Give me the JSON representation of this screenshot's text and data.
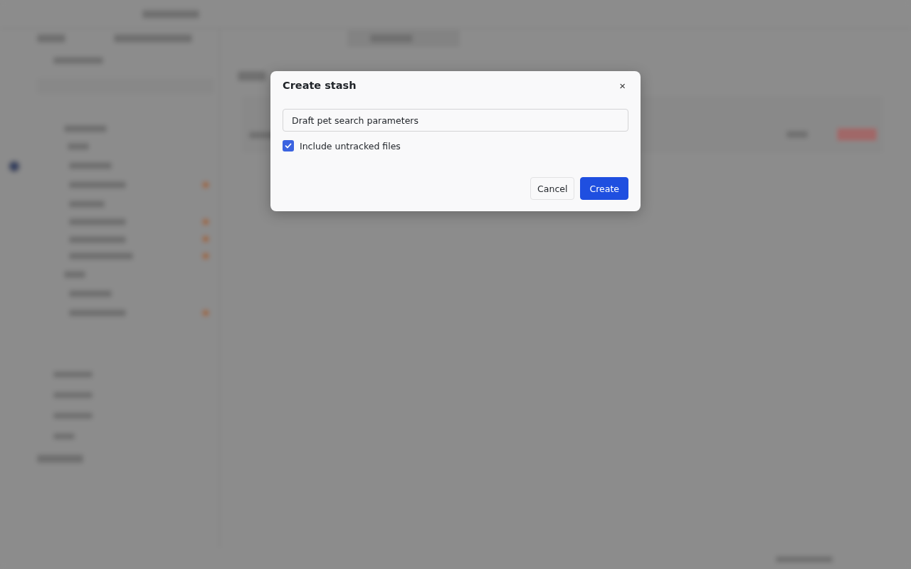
{
  "dialog": {
    "title": "Create stash",
    "close": "×",
    "name_field": {
      "value": "Draft pet search parameters"
    },
    "include_untracked": {
      "label": "Include untracked files",
      "checked": true
    },
    "buttons": [
      {
        "label": "Cancel",
        "kind": "secondary"
      },
      {
        "label": "Create",
        "kind": "primary"
      }
    ]
  }
}
